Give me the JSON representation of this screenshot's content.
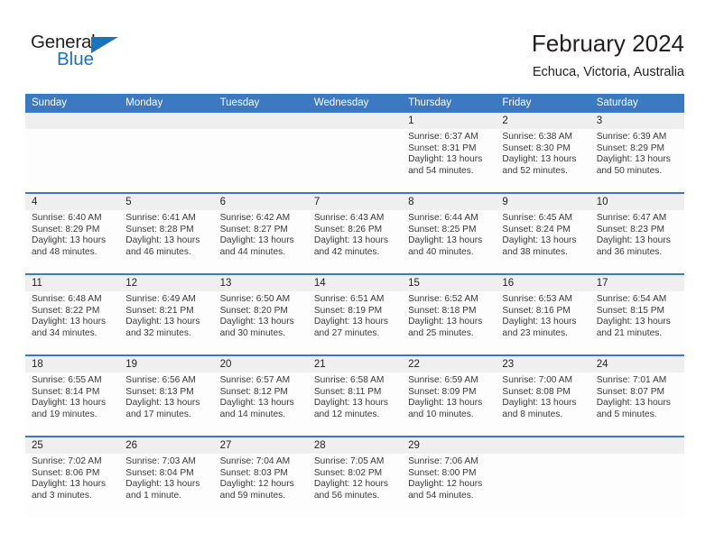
{
  "brand": {
    "line1": "General",
    "line2": "Blue",
    "triangle_color": "#1b74bb",
    "text_color": "#231f20"
  },
  "header": {
    "title": "February 2024",
    "subtitle": "Echuca, Victoria, Australia"
  },
  "colors": {
    "header_blue": "#3b79c2",
    "daynum_band": "#efefef",
    "page_background": "#ffffff",
    "text": "#231f20"
  },
  "weekday_headers": [
    "Sunday",
    "Monday",
    "Tuesday",
    "Wednesday",
    "Thursday",
    "Friday",
    "Saturday"
  ],
  "weeks": [
    [
      {
        "empty": true
      },
      {
        "empty": true
      },
      {
        "empty": true
      },
      {
        "empty": true
      },
      {
        "day": "1",
        "sunrise": "Sunrise: 6:37 AM",
        "sunset": "Sunset: 8:31 PM",
        "daylight1": "Daylight: 13 hours",
        "daylight2": "and 54 minutes."
      },
      {
        "day": "2",
        "sunrise": "Sunrise: 6:38 AM",
        "sunset": "Sunset: 8:30 PM",
        "daylight1": "Daylight: 13 hours",
        "daylight2": "and 52 minutes."
      },
      {
        "day": "3",
        "sunrise": "Sunrise: 6:39 AM",
        "sunset": "Sunset: 8:29 PM",
        "daylight1": "Daylight: 13 hours",
        "daylight2": "and 50 minutes."
      }
    ],
    [
      {
        "day": "4",
        "sunrise": "Sunrise: 6:40 AM",
        "sunset": "Sunset: 8:29 PM",
        "daylight1": "Daylight: 13 hours",
        "daylight2": "and 48 minutes."
      },
      {
        "day": "5",
        "sunrise": "Sunrise: 6:41 AM",
        "sunset": "Sunset: 8:28 PM",
        "daylight1": "Daylight: 13 hours",
        "daylight2": "and 46 minutes."
      },
      {
        "day": "6",
        "sunrise": "Sunrise: 6:42 AM",
        "sunset": "Sunset: 8:27 PM",
        "daylight1": "Daylight: 13 hours",
        "daylight2": "and 44 minutes."
      },
      {
        "day": "7",
        "sunrise": "Sunrise: 6:43 AM",
        "sunset": "Sunset: 8:26 PM",
        "daylight1": "Daylight: 13 hours",
        "daylight2": "and 42 minutes."
      },
      {
        "day": "8",
        "sunrise": "Sunrise: 6:44 AM",
        "sunset": "Sunset: 8:25 PM",
        "daylight1": "Daylight: 13 hours",
        "daylight2": "and 40 minutes."
      },
      {
        "day": "9",
        "sunrise": "Sunrise: 6:45 AM",
        "sunset": "Sunset: 8:24 PM",
        "daylight1": "Daylight: 13 hours",
        "daylight2": "and 38 minutes."
      },
      {
        "day": "10",
        "sunrise": "Sunrise: 6:47 AM",
        "sunset": "Sunset: 8:23 PM",
        "daylight1": "Daylight: 13 hours",
        "daylight2": "and 36 minutes."
      }
    ],
    [
      {
        "day": "11",
        "sunrise": "Sunrise: 6:48 AM",
        "sunset": "Sunset: 8:22 PM",
        "daylight1": "Daylight: 13 hours",
        "daylight2": "and 34 minutes."
      },
      {
        "day": "12",
        "sunrise": "Sunrise: 6:49 AM",
        "sunset": "Sunset: 8:21 PM",
        "daylight1": "Daylight: 13 hours",
        "daylight2": "and 32 minutes."
      },
      {
        "day": "13",
        "sunrise": "Sunrise: 6:50 AM",
        "sunset": "Sunset: 8:20 PM",
        "daylight1": "Daylight: 13 hours",
        "daylight2": "and 30 minutes."
      },
      {
        "day": "14",
        "sunrise": "Sunrise: 6:51 AM",
        "sunset": "Sunset: 8:19 PM",
        "daylight1": "Daylight: 13 hours",
        "daylight2": "and 27 minutes."
      },
      {
        "day": "15",
        "sunrise": "Sunrise: 6:52 AM",
        "sunset": "Sunset: 8:18 PM",
        "daylight1": "Daylight: 13 hours",
        "daylight2": "and 25 minutes."
      },
      {
        "day": "16",
        "sunrise": "Sunrise: 6:53 AM",
        "sunset": "Sunset: 8:16 PM",
        "daylight1": "Daylight: 13 hours",
        "daylight2": "and 23 minutes."
      },
      {
        "day": "17",
        "sunrise": "Sunrise: 6:54 AM",
        "sunset": "Sunset: 8:15 PM",
        "daylight1": "Daylight: 13 hours",
        "daylight2": "and 21 minutes."
      }
    ],
    [
      {
        "day": "18",
        "sunrise": "Sunrise: 6:55 AM",
        "sunset": "Sunset: 8:14 PM",
        "daylight1": "Daylight: 13 hours",
        "daylight2": "and 19 minutes."
      },
      {
        "day": "19",
        "sunrise": "Sunrise: 6:56 AM",
        "sunset": "Sunset: 8:13 PM",
        "daylight1": "Daylight: 13 hours",
        "daylight2": "and 17 minutes."
      },
      {
        "day": "20",
        "sunrise": "Sunrise: 6:57 AM",
        "sunset": "Sunset: 8:12 PM",
        "daylight1": "Daylight: 13 hours",
        "daylight2": "and 14 minutes."
      },
      {
        "day": "21",
        "sunrise": "Sunrise: 6:58 AM",
        "sunset": "Sunset: 8:11 PM",
        "daylight1": "Daylight: 13 hours",
        "daylight2": "and 12 minutes."
      },
      {
        "day": "22",
        "sunrise": "Sunrise: 6:59 AM",
        "sunset": "Sunset: 8:09 PM",
        "daylight1": "Daylight: 13 hours",
        "daylight2": "and 10 minutes."
      },
      {
        "day": "23",
        "sunrise": "Sunrise: 7:00 AM",
        "sunset": "Sunset: 8:08 PM",
        "daylight1": "Daylight: 13 hours",
        "daylight2": "and 8 minutes."
      },
      {
        "day": "24",
        "sunrise": "Sunrise: 7:01 AM",
        "sunset": "Sunset: 8:07 PM",
        "daylight1": "Daylight: 13 hours",
        "daylight2": "and 5 minutes."
      }
    ],
    [
      {
        "day": "25",
        "sunrise": "Sunrise: 7:02 AM",
        "sunset": "Sunset: 8:06 PM",
        "daylight1": "Daylight: 13 hours",
        "daylight2": "and 3 minutes."
      },
      {
        "day": "26",
        "sunrise": "Sunrise: 7:03 AM",
        "sunset": "Sunset: 8:04 PM",
        "daylight1": "Daylight: 13 hours",
        "daylight2": "and 1 minute."
      },
      {
        "day": "27",
        "sunrise": "Sunrise: 7:04 AM",
        "sunset": "Sunset: 8:03 PM",
        "daylight1": "Daylight: 12 hours",
        "daylight2": "and 59 minutes."
      },
      {
        "day": "28",
        "sunrise": "Sunrise: 7:05 AM",
        "sunset": "Sunset: 8:02 PM",
        "daylight1": "Daylight: 12 hours",
        "daylight2": "and 56 minutes."
      },
      {
        "day": "29",
        "sunrise": "Sunrise: 7:06 AM",
        "sunset": "Sunset: 8:00 PM",
        "daylight1": "Daylight: 12 hours",
        "daylight2": "and 54 minutes."
      },
      {
        "empty": true
      },
      {
        "empty": true
      }
    ]
  ]
}
